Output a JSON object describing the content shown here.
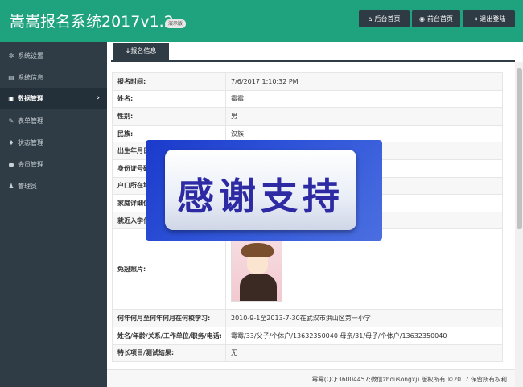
{
  "header": {
    "title": "嵩嵩报名系统2017v1.2",
    "demo_badge": "演示版",
    "buttons": [
      {
        "label": "后台首页",
        "icon": "home-icon"
      },
      {
        "label": "前台首页",
        "icon": "eye-icon"
      },
      {
        "label": "退出登陆",
        "icon": "logout-icon"
      }
    ]
  },
  "sidebar": {
    "items": [
      {
        "label": "系统设置",
        "icon": "gear-icon"
      },
      {
        "label": "系统信息",
        "icon": "chart-icon"
      },
      {
        "label": "数据管理",
        "icon": "image-icon",
        "active": true
      },
      {
        "label": "表单管理",
        "icon": "edit-icon"
      },
      {
        "label": "状态管理",
        "icon": "lightbulb-icon"
      },
      {
        "label": "会员管理",
        "icon": "user-icon"
      },
      {
        "label": "管理员",
        "icon": "group-icon"
      }
    ]
  },
  "tab": {
    "label": "报名信息",
    "icon": "arrow-down-icon"
  },
  "details": [
    {
      "key": "报名时间:",
      "value": "7/6/2017 1:10:32 PM"
    },
    {
      "key": "姓名:",
      "value": "霉霉"
    },
    {
      "key": "性别:",
      "value": "男"
    },
    {
      "key": "民族:",
      "value": "汉族"
    },
    {
      "key": "出生年月日",
      "value": ""
    },
    {
      "key": "身份证号码",
      "value": ""
    },
    {
      "key": "户口所在地",
      "value": ""
    },
    {
      "key": "家庭详细住",
      "value": ""
    },
    {
      "key": "就近入学代",
      "value": ""
    },
    {
      "key": "免冠照片:",
      "value": ""
    },
    {
      "key": "何年何月至何年何月在何校学习:",
      "value": "2010-9-1至2013-7-30在武汉市洪山区第一小学"
    },
    {
      "key": "姓名/年龄/关系/工作单位/职务/电话:",
      "value": "霉霉/33/父子/个体户/13632350040 母亲/31/母子/个体户/13632350040"
    },
    {
      "key": "特长项目/测试结果:",
      "value": "无"
    }
  ],
  "overlay": {
    "text": "感谢支持"
  },
  "footer": {
    "text": "霉霉(QQ:36004457;微信zhousongxj) 版权所有 ©2017 保留所有权利"
  },
  "colors": {
    "brand": "#1fa27e",
    "sidebar": "#2f3c45",
    "button": "#2f3b44"
  }
}
